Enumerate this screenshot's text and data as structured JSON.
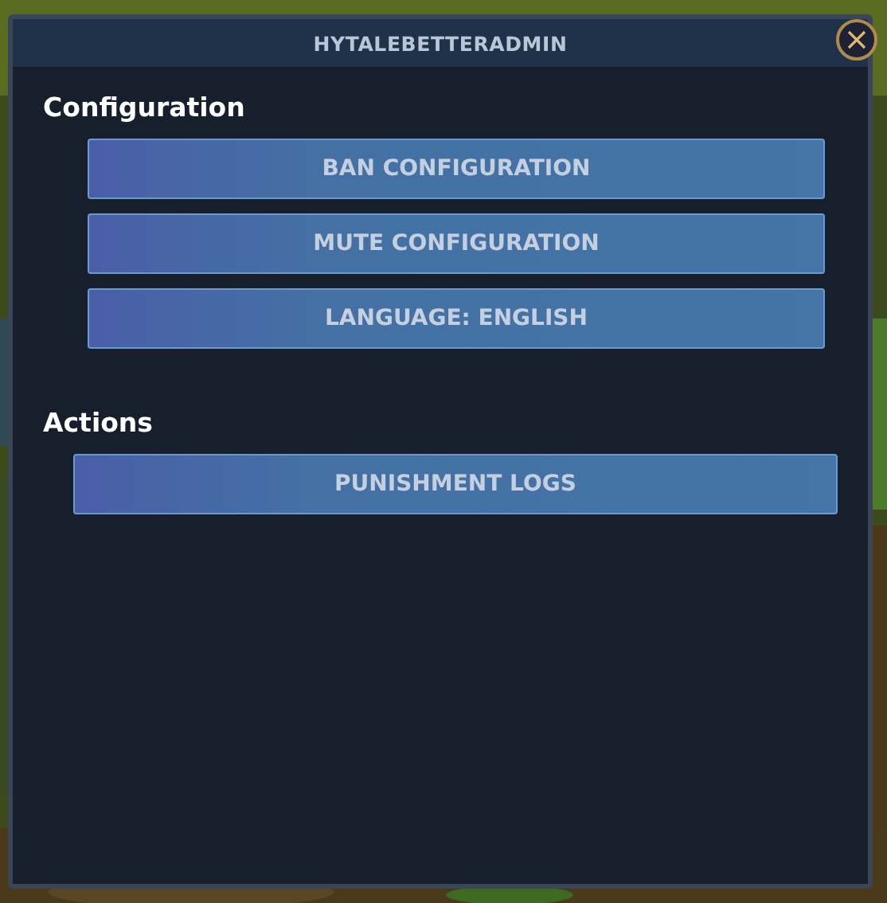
{
  "window": {
    "title": "HYTALEBETTERADMIN"
  },
  "sections": [
    {
      "heading": "Configuration",
      "buttons": [
        "BAN CONFIGURATION",
        "MUTE CONFIGURATION",
        "LANGUAGE: ENGLISH"
      ]
    },
    {
      "heading": "Actions",
      "buttons": [
        "PUNISHMENT LOGS"
      ]
    }
  ]
}
